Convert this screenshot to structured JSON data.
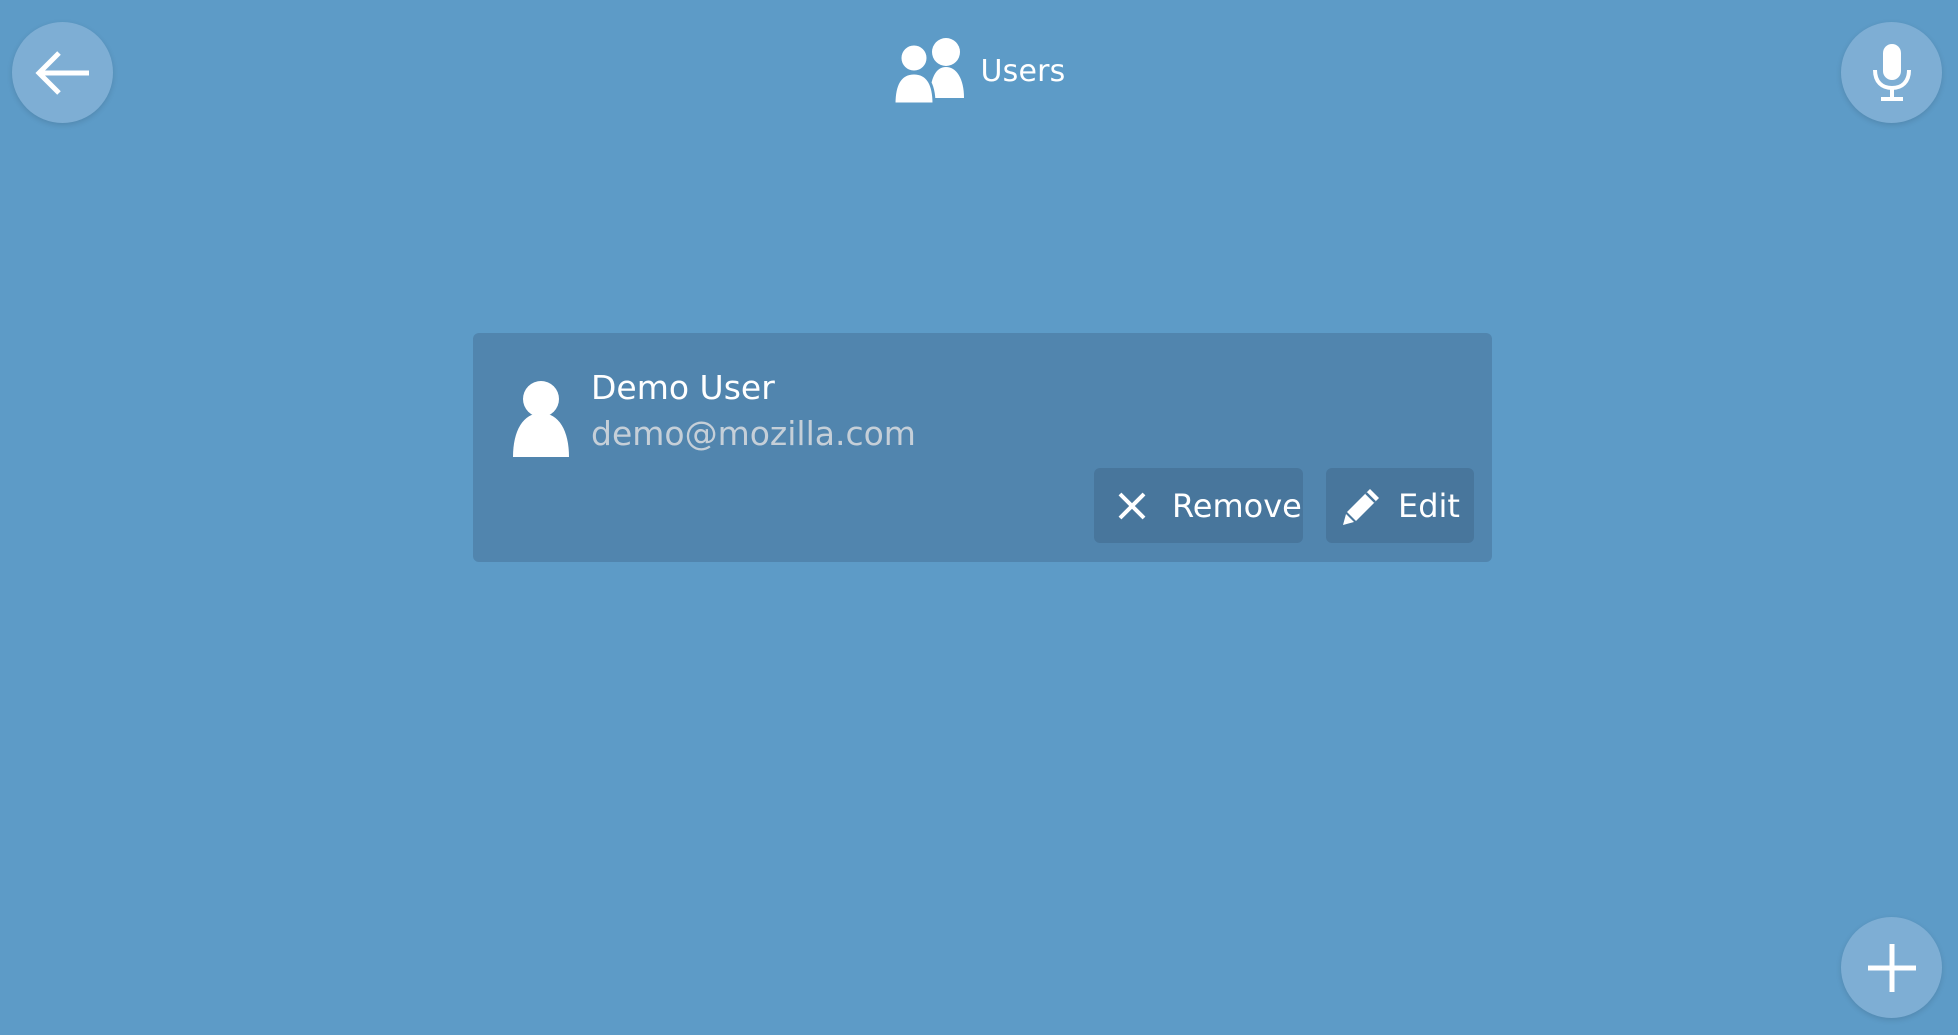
{
  "header": {
    "title": "Users",
    "title_icon": "users-icon"
  },
  "toolbar": {
    "back_icon": "arrow-left-icon",
    "mic_icon": "microphone-icon",
    "add_icon": "plus-icon"
  },
  "users": [
    {
      "name": "Demo User",
      "email": "demo@mozilla.com",
      "avatar_icon": "user-icon",
      "actions": {
        "remove_label": "Remove",
        "remove_icon": "close-icon",
        "edit_label": "Edit",
        "edit_icon": "pencil-icon"
      }
    }
  ],
  "colors": {
    "background": "#5d9bc7",
    "card": "#5185ae",
    "button": "#48769c",
    "fab": "#7eaed4",
    "email_text": "#c5cfd8"
  }
}
